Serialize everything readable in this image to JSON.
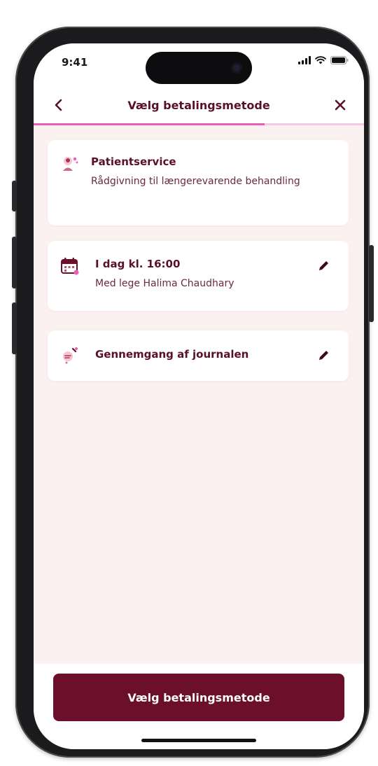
{
  "status_bar": {
    "time": "9:41",
    "icons": [
      "signal-icon",
      "wifi-icon",
      "battery-icon"
    ]
  },
  "nav": {
    "title": "Vælg betalingsmetode",
    "back_icon": "chevron-left-icon",
    "close_icon": "close-icon"
  },
  "progress": {
    "value": 0.7,
    "fill_color": "#e85fb8",
    "track_color": "#f3c9e3"
  },
  "cards": {
    "service": {
      "icon": "patient-service-icon",
      "title": "Patientservice",
      "subtitle": "Rådgivning til længerevarende behandling"
    },
    "appointment": {
      "icon": "calendar-icon",
      "title": "I dag kl. 16:00",
      "subtitle": "Med lege Halima Chaudhary",
      "edit_icon": "pencil-icon"
    },
    "topic": {
      "icon": "topic-icon",
      "title": "Gennemgang af journalen",
      "edit_icon": "pencil-icon"
    }
  },
  "footer": {
    "primary_button": "Vælg betalingsmetode"
  },
  "colors": {
    "brand": "#6b0f2a",
    "title_text": "#5a1126",
    "background": "#fbf1f1",
    "accent_pink": "#e85fb8"
  }
}
